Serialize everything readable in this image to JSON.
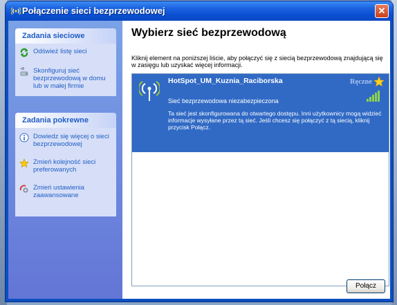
{
  "window": {
    "title": "Połączenie sieci bezprzewodowej",
    "close_icon": "close-icon"
  },
  "sidebar": {
    "network_tasks": {
      "heading": "Zadania sieciowe",
      "items": [
        {
          "label": "Odśwież listę sieci",
          "icon": "refresh-icon"
        },
        {
          "label": "Skonfiguruj sieć bezprzewodową w domu lub w małej firmie",
          "icon": "setup-network-icon"
        }
      ]
    },
    "related_tasks": {
      "heading": "Zadania pokrewne",
      "items": [
        {
          "label": "Dowiedz się więcej o sieci bezprzewodowej",
          "icon": "info-icon"
        },
        {
          "label": "Zmień kolejność sieci preferowanych",
          "icon": "star-icon"
        },
        {
          "label": "Zmień ustawienia zaawansowane",
          "icon": "settings-icon"
        }
      ]
    }
  },
  "main": {
    "title": "Wybierz sieć bezprzewodową",
    "description": "Kliknij element na poniższej liście, aby połączyć się z siecią bezprzewodową znajdującą się w zasięgu lub uzyskać więcej informacji.",
    "networks": [
      {
        "name": "HotSpot_UM_Kuznia_Raciborska",
        "mode": "Ręczne",
        "security": "Sieć bezprzewodowa niezabezpieczona",
        "info": "Ta sieć jest skonfigurowana do otwartego dostępu. Inni użytkownicy mogą widzieć informacje wysyłane przez tą sieć. Jeśli chcesz się połączyć z tą siecią, kliknij przycisk Połącz.",
        "signal_level": "5/5"
      }
    ],
    "connect_button": "Połącz"
  },
  "colors": {
    "titlebar": "#0a4fd2",
    "sidebar": "#6d8ee0",
    "selection": "#316ac5",
    "link": "#215dc6"
  }
}
